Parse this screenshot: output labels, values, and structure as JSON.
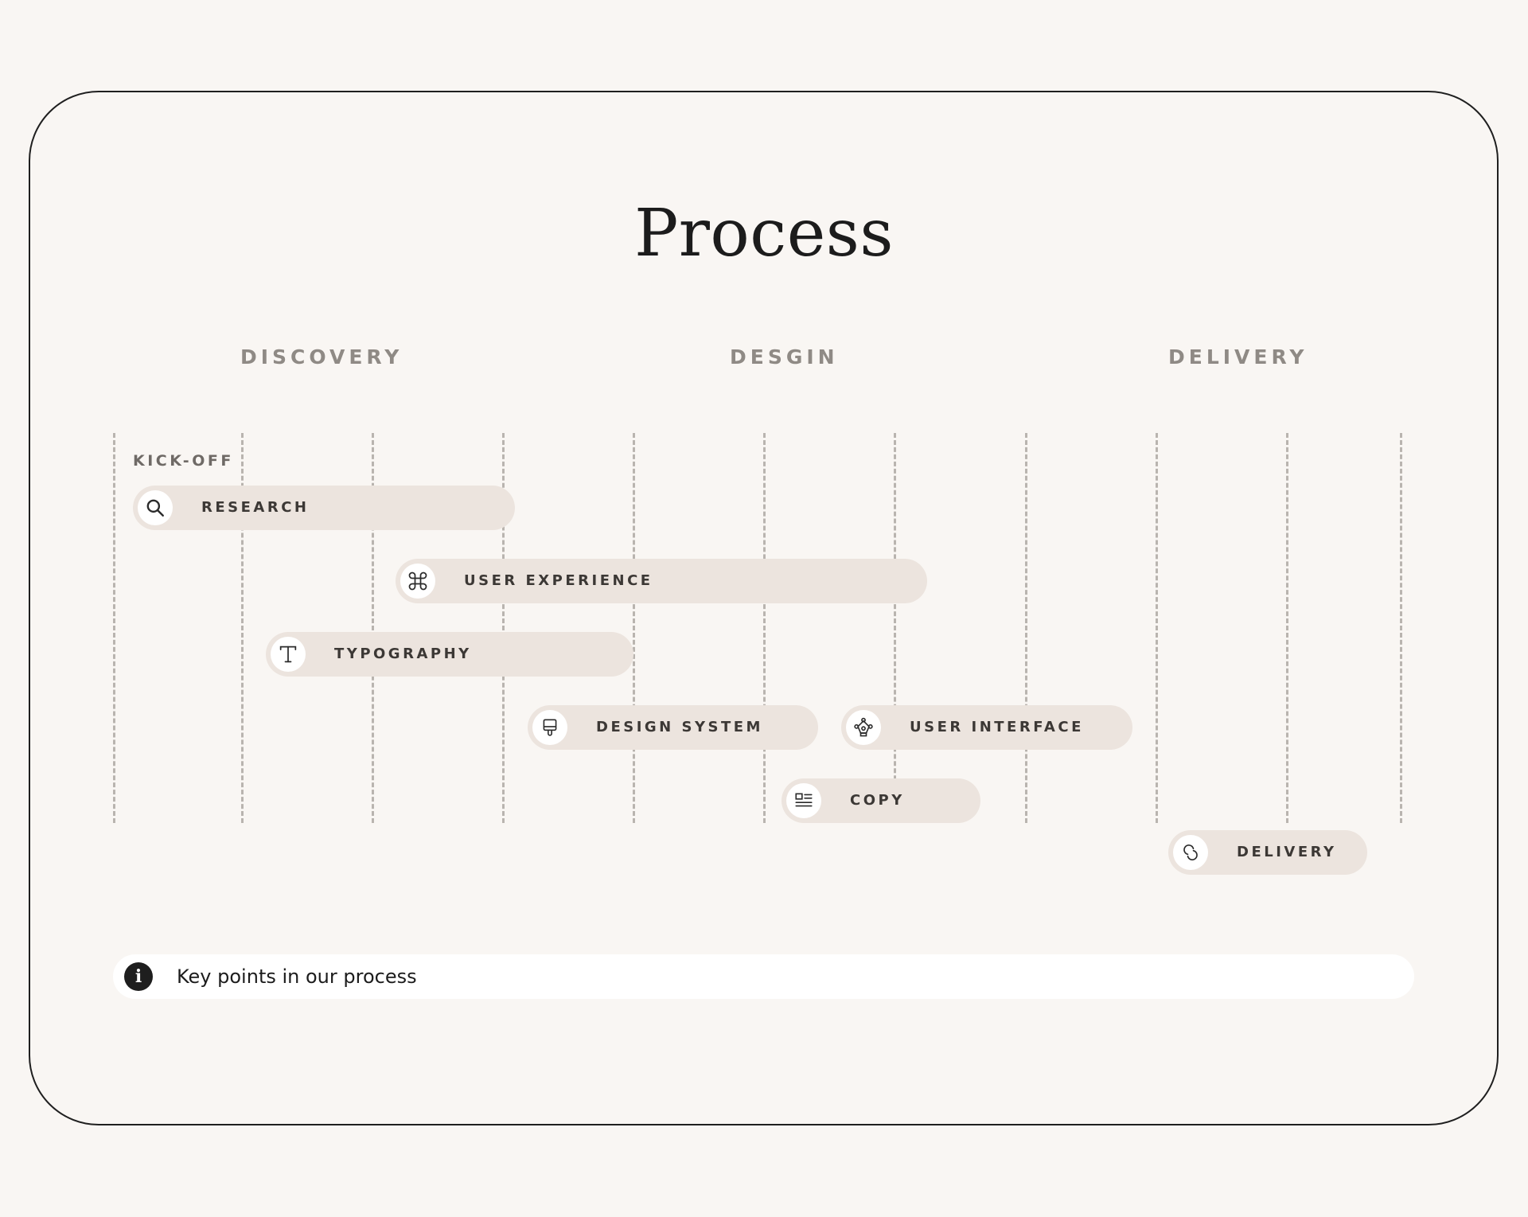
{
  "title": "Process",
  "phases": [
    "DISCOVERY",
    "DESGIN",
    "DELIVERY"
  ],
  "kickoff_label": "KICK-OFF",
  "tasks": [
    {
      "label": "RESEARCH",
      "icon": "search-icon"
    },
    {
      "label": "USER EXPERIENCE",
      "icon": "command-icon"
    },
    {
      "label": "TYPOGRAPHY",
      "icon": "typography-icon"
    },
    {
      "label": "DESIGN SYSTEM",
      "icon": "design-system-icon"
    },
    {
      "label": "USER INTERFACE",
      "icon": "vector-nodes-icon"
    },
    {
      "label": "COPY",
      "icon": "text-list-icon"
    },
    {
      "label": "DELIVERY",
      "icon": "link-icon"
    }
  ],
  "info": {
    "icon": "info-icon",
    "text": "Key points in our process"
  },
  "colors": {
    "background": "#f9f6f3",
    "pill": "#ece4de",
    "grid_line": "#b9b4af",
    "phase_text": "#8f8a85",
    "text": "#1c1c1c"
  }
}
